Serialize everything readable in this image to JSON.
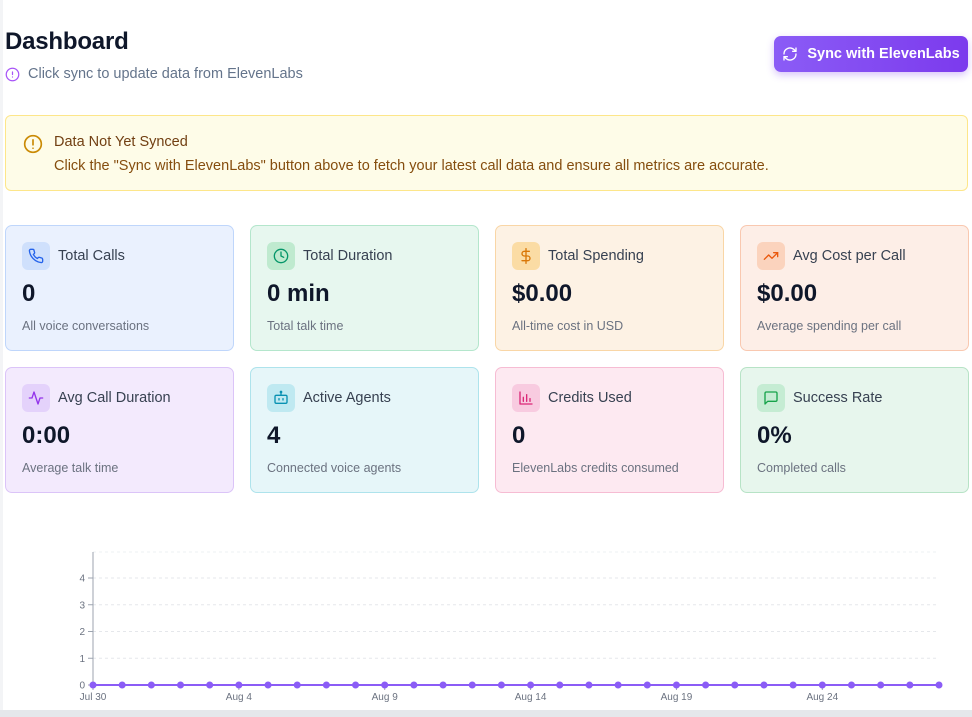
{
  "header": {
    "title": "Dashboard",
    "subtitle": "Click sync to update data from ElevenLabs",
    "sync_button_label": "Sync with ElevenLabs"
  },
  "alert": {
    "title": "Data Not Yet Synced",
    "message": "Click the \"Sync with ElevenLabs\" button above to fetch your latest call data and ensure all metrics are accurate."
  },
  "stats": [
    {
      "label": "Total Calls",
      "value": "0",
      "desc": "All voice conversations",
      "icon": "phone-icon"
    },
    {
      "label": "Total Duration",
      "value": "0 min",
      "desc": "Total talk time",
      "icon": "clock-icon"
    },
    {
      "label": "Total Spending",
      "value": "$0.00",
      "desc": "All-time cost in USD",
      "icon": "dollar-icon"
    },
    {
      "label": "Avg Cost per Call",
      "value": "$0.00",
      "desc": "Average spending per call",
      "icon": "trending-up-icon"
    },
    {
      "label": "Avg Call Duration",
      "value": "0:00",
      "desc": "Average talk time",
      "icon": "activity-icon"
    },
    {
      "label": "Active Agents",
      "value": "4",
      "desc": "Connected voice agents",
      "icon": "bot-icon"
    },
    {
      "label": "Credits Used",
      "value": "0",
      "desc": "ElevenLabs credits consumed",
      "icon": "bar-chart-icon"
    },
    {
      "label": "Success Rate",
      "value": "0%",
      "desc": "Completed calls",
      "icon": "message-square-icon"
    }
  ],
  "colors": {
    "accent": "#7c3aed",
    "line": "#8b5cf6",
    "alert_bg": "#fefce8",
    "alert_border": "#fde68a"
  },
  "chart_data": {
    "type": "line",
    "title": "",
    "xlabel": "",
    "ylabel": "",
    "ylim": [
      0,
      4
    ],
    "yticks": [
      "0",
      "1",
      "2",
      "3",
      "4"
    ],
    "xtick_labels": [
      "Jul 30",
      "Aug 4",
      "Aug 9",
      "Aug 14",
      "Aug 19",
      "Aug 24"
    ],
    "x": [
      "Jul 30",
      "Jul 31",
      "Aug 1",
      "Aug 2",
      "Aug 3",
      "Aug 4",
      "Aug 5",
      "Aug 6",
      "Aug 7",
      "Aug 8",
      "Aug 9",
      "Aug 10",
      "Aug 11",
      "Aug 12",
      "Aug 13",
      "Aug 14",
      "Aug 15",
      "Aug 16",
      "Aug 17",
      "Aug 18",
      "Aug 19",
      "Aug 20",
      "Aug 21",
      "Aug 22",
      "Aug 23",
      "Aug 24",
      "Aug 25",
      "Aug 26",
      "Aug 27",
      "Aug 28"
    ],
    "series": [
      {
        "values": [
          0,
          0,
          0,
          0,
          0,
          0,
          0,
          0,
          0,
          0,
          0,
          0,
          0,
          0,
          0,
          0,
          0,
          0,
          0,
          0,
          0,
          0,
          0,
          0,
          0,
          0,
          0,
          0,
          0,
          0
        ]
      }
    ],
    "grid": true
  }
}
